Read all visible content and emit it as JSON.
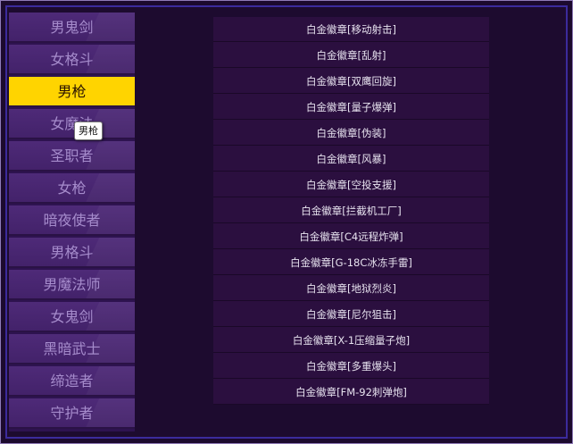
{
  "classes": [
    {
      "label": "男鬼剑",
      "selected": false
    },
    {
      "label": "女格斗",
      "selected": false
    },
    {
      "label": "男枪",
      "selected": true
    },
    {
      "label": "女魔法",
      "selected": false
    },
    {
      "label": "圣职者",
      "selected": false
    },
    {
      "label": "女枪",
      "selected": false
    },
    {
      "label": "暗夜使者",
      "selected": false
    },
    {
      "label": "男格斗",
      "selected": false
    },
    {
      "label": "男魔法师",
      "selected": false
    },
    {
      "label": "女鬼剑",
      "selected": false
    },
    {
      "label": "黑暗武士",
      "selected": false
    },
    {
      "label": "缔造者",
      "selected": false
    },
    {
      "label": "守护者",
      "selected": false
    }
  ],
  "tooltip": {
    "text": "男枪"
  },
  "items": [
    "白金徽章[移动射击]",
    "白金徽章[乱射]",
    "白金徽章[双鹰回旋]",
    "白金徽章[量子爆弹]",
    "白金徽章[伪装]",
    "白金徽章[风暴]",
    "白金徽章[空投支援]",
    "白金徽章[拦截机工厂]",
    "白金徽章[C4远程炸弹]",
    "白金徽章[G-18C冰冻手雷]",
    "白金徽章[地狱烈炎]",
    "白金徽章[尼尔狙击]",
    "白金徽章[X-1压缩量子炮]",
    "白金徽章[多重爆头]",
    "白金徽章[FM-92刺弹炮]"
  ],
  "colors": {
    "selected_bg": "#ffd400",
    "item_text": "#a68ccc",
    "list_bg": "#2b0f3f"
  }
}
